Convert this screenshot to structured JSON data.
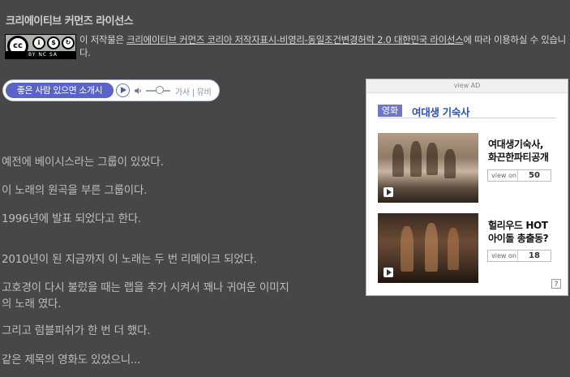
{
  "license": {
    "title": "크리에이티브 커먼즈 라이선스",
    "badge_label": "BY NC SA",
    "badge_cc": "cc",
    "text_prefix": "이 저작물은 ",
    "link_text": "크리에이티브 커먼즈 코리아 저작자표시-비영리-동일조건변경허락 2.0 대한민국 라이선스",
    "text_suffix": "에 따라 이용하실 수 있습니다."
  },
  "player": {
    "song_title": "좋은 사람 있으면 소개시",
    "lyrics_label": "가사",
    "mv_label": "뮤비",
    "separator": "|",
    "volume_level": 0.5
  },
  "post": {
    "paragraphs": [
      "예전에 베이시스라는 그룹이 있었다.",
      "이 노래의 원곡을 부른 그룹이다.",
      "1996년에 발표 되었다고 한다.",
      "2010년이 된 지금까지 이 노래는 두 번 리메이크 되었다.",
      "고호경이 다시 불렀을 때는 랩을 추가 시켜서 꽤나 귀여운 이미지",
      "의 노래 였다.",
      "그리고 럼블피쉬가 한 번 더 했다.",
      "같은 제목의 영화도 있었으니..."
    ]
  },
  "ad": {
    "bar_label": "view AD",
    "category": "영화",
    "category_title": "여대생 기숙사",
    "items": [
      {
        "title_line1": "여대생기숙사,",
        "title_line2": "화끈한파티공개",
        "view_label": "view on",
        "count": "50"
      },
      {
        "title_line1": "헐리우드 HOT",
        "title_line2": "아이돌 총출동?",
        "view_label": "view on",
        "count": "18"
      }
    ],
    "help": "?"
  },
  "colors": {
    "background": "#474747",
    "player_accent": "#5a63c8",
    "ad_title": "#2b4eb0"
  }
}
